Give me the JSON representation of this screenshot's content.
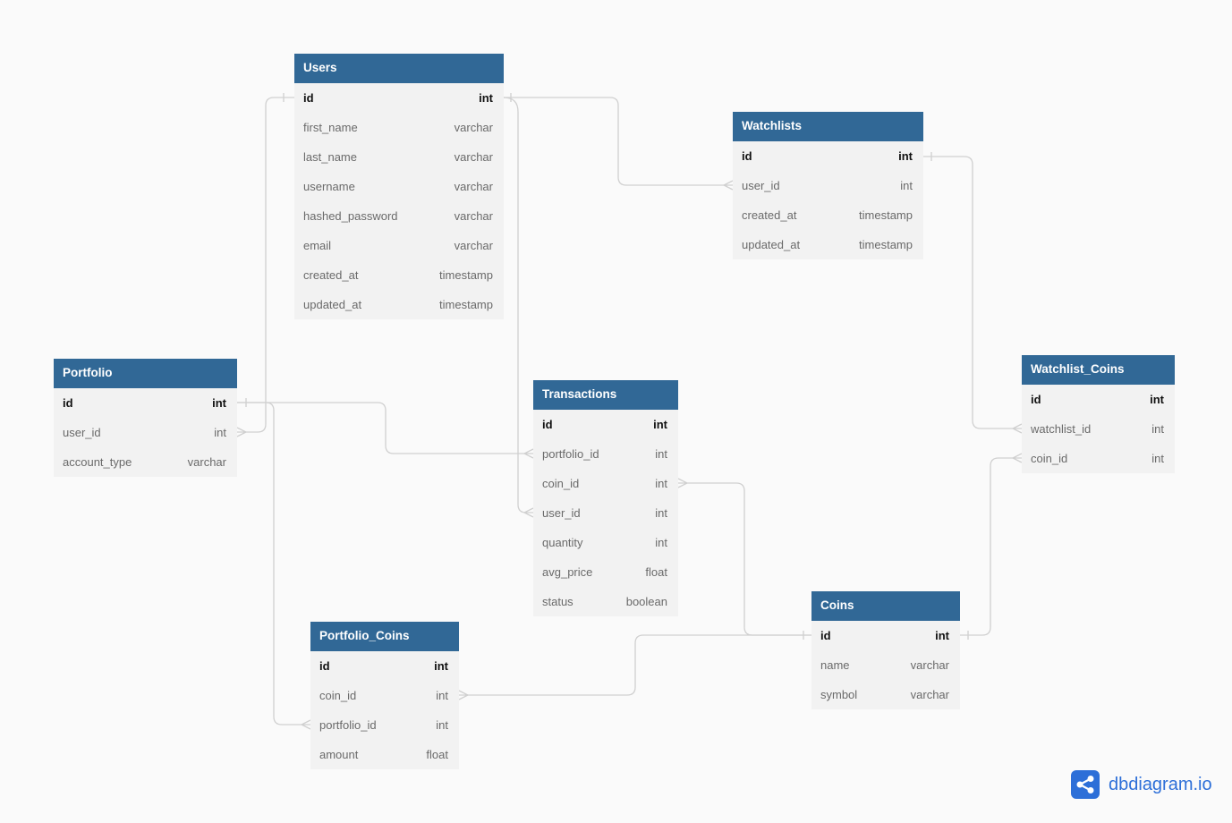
{
  "tables": {
    "users": {
      "name": "Users",
      "columns": [
        {
          "name": "id",
          "type": "int"
        },
        {
          "name": "first_name",
          "type": "varchar"
        },
        {
          "name": "last_name",
          "type": "varchar"
        },
        {
          "name": "username",
          "type": "varchar"
        },
        {
          "name": "hashed_password",
          "type": "varchar"
        },
        {
          "name": "email",
          "type": "varchar"
        },
        {
          "name": "created_at",
          "type": "timestamp"
        },
        {
          "name": "updated_at",
          "type": "timestamp"
        }
      ]
    },
    "watchlists": {
      "name": "Watchlists",
      "columns": [
        {
          "name": "id",
          "type": "int"
        },
        {
          "name": "user_id",
          "type": "int"
        },
        {
          "name": "created_at",
          "type": "timestamp"
        },
        {
          "name": "updated_at",
          "type": "timestamp"
        }
      ]
    },
    "portfolio": {
      "name": "Portfolio",
      "columns": [
        {
          "name": "id",
          "type": "int"
        },
        {
          "name": "user_id",
          "type": "int"
        },
        {
          "name": "account_type",
          "type": "varchar"
        }
      ]
    },
    "transactions": {
      "name": "Transactions",
      "columns": [
        {
          "name": "id",
          "type": "int"
        },
        {
          "name": "portfolio_id",
          "type": "int"
        },
        {
          "name": "coin_id",
          "type": "int"
        },
        {
          "name": "user_id",
          "type": "int"
        },
        {
          "name": "quantity",
          "type": "int"
        },
        {
          "name": "avg_price",
          "type": "float"
        },
        {
          "name": "status",
          "type": "boolean"
        }
      ]
    },
    "watchlist_coins": {
      "name": "Watchlist_Coins",
      "columns": [
        {
          "name": "id",
          "type": "int"
        },
        {
          "name": "watchlist_id",
          "type": "int"
        },
        {
          "name": "coin_id",
          "type": "int"
        }
      ]
    },
    "coins": {
      "name": "Coins",
      "columns": [
        {
          "name": "id",
          "type": "int"
        },
        {
          "name": "name",
          "type": "varchar"
        },
        {
          "name": "symbol",
          "type": "varchar"
        }
      ]
    },
    "portfolio_coins": {
      "name": "Portfolio_Coins",
      "columns": [
        {
          "name": "id",
          "type": "int"
        },
        {
          "name": "coin_id",
          "type": "int"
        },
        {
          "name": "portfolio_id",
          "type": "int"
        },
        {
          "name": "amount",
          "type": "float"
        }
      ]
    }
  },
  "relationships": [
    {
      "from": "Portfolio.user_id",
      "to": "Users.id",
      "type": "many-to-one"
    },
    {
      "from": "Watchlists.user_id",
      "to": "Users.id",
      "type": "many-to-one"
    },
    {
      "from": "Transactions.user_id",
      "to": "Users.id",
      "type": "many-to-one"
    },
    {
      "from": "Transactions.portfolio_id",
      "to": "Portfolio.id",
      "type": "many-to-one"
    },
    {
      "from": "Portfolio_Coins.portfolio_id",
      "to": "Portfolio.id",
      "type": "many-to-one"
    },
    {
      "from": "Watchlist_Coins.watchlist_id",
      "to": "Watchlists.id",
      "type": "many-to-one"
    },
    {
      "from": "Watchlist_Coins.coin_id",
      "to": "Coins.id",
      "type": "many-to-one"
    },
    {
      "from": "Transactions.coin_id",
      "to": "Coins.id",
      "type": "many-to-one"
    },
    {
      "from": "Portfolio_Coins.coin_id",
      "to": "Coins.id",
      "type": "many-to-one"
    }
  ],
  "logo": {
    "text": "dbdiagram.io",
    "icon": "share-nodes-icon"
  }
}
